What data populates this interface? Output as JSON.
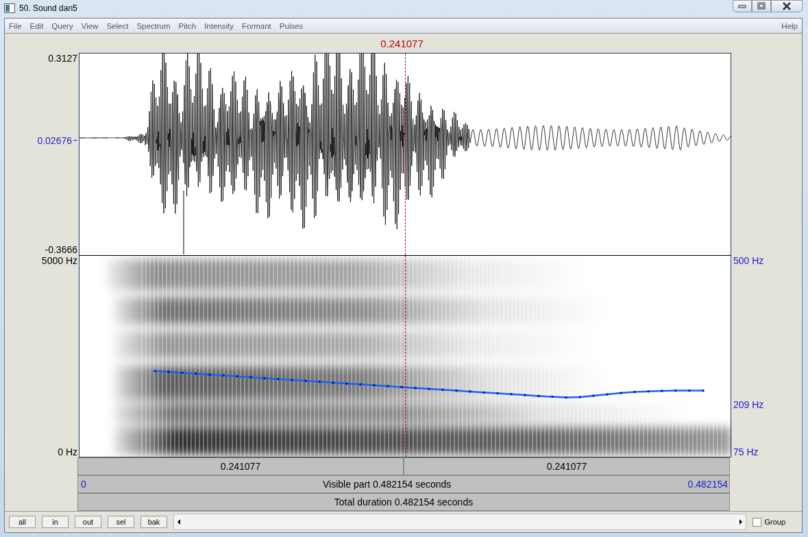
{
  "window": {
    "title": "50. Sound dan5"
  },
  "menu": {
    "items": [
      "File",
      "Edit",
      "Query",
      "View",
      "Select",
      "Spectrum",
      "Pitch",
      "Intensity",
      "Formant",
      "Pulses"
    ],
    "help": "Help"
  },
  "cursor_time": "0.241077",
  "waveform": {
    "y_max": "0.3127",
    "y_mid": "0.02676",
    "y_min": "-0.3666"
  },
  "spectrogram": {
    "freq_max": "5000 Hz",
    "freq_min": "0 Hz",
    "pitch_max": "500 Hz",
    "pitch_mid": "209 Hz",
    "pitch_min": "75 Hz"
  },
  "time_bar": {
    "left_half": "0.241077",
    "right_half": "0.241077",
    "start": "0",
    "visible": "Visible part 0.482154 seconds",
    "end": "0.482154",
    "total": "Total duration 0.482154 seconds"
  },
  "buttons": [
    "all",
    "in",
    "out",
    "sel",
    "bak"
  ],
  "group": {
    "label": "Group",
    "checked": false
  }
}
